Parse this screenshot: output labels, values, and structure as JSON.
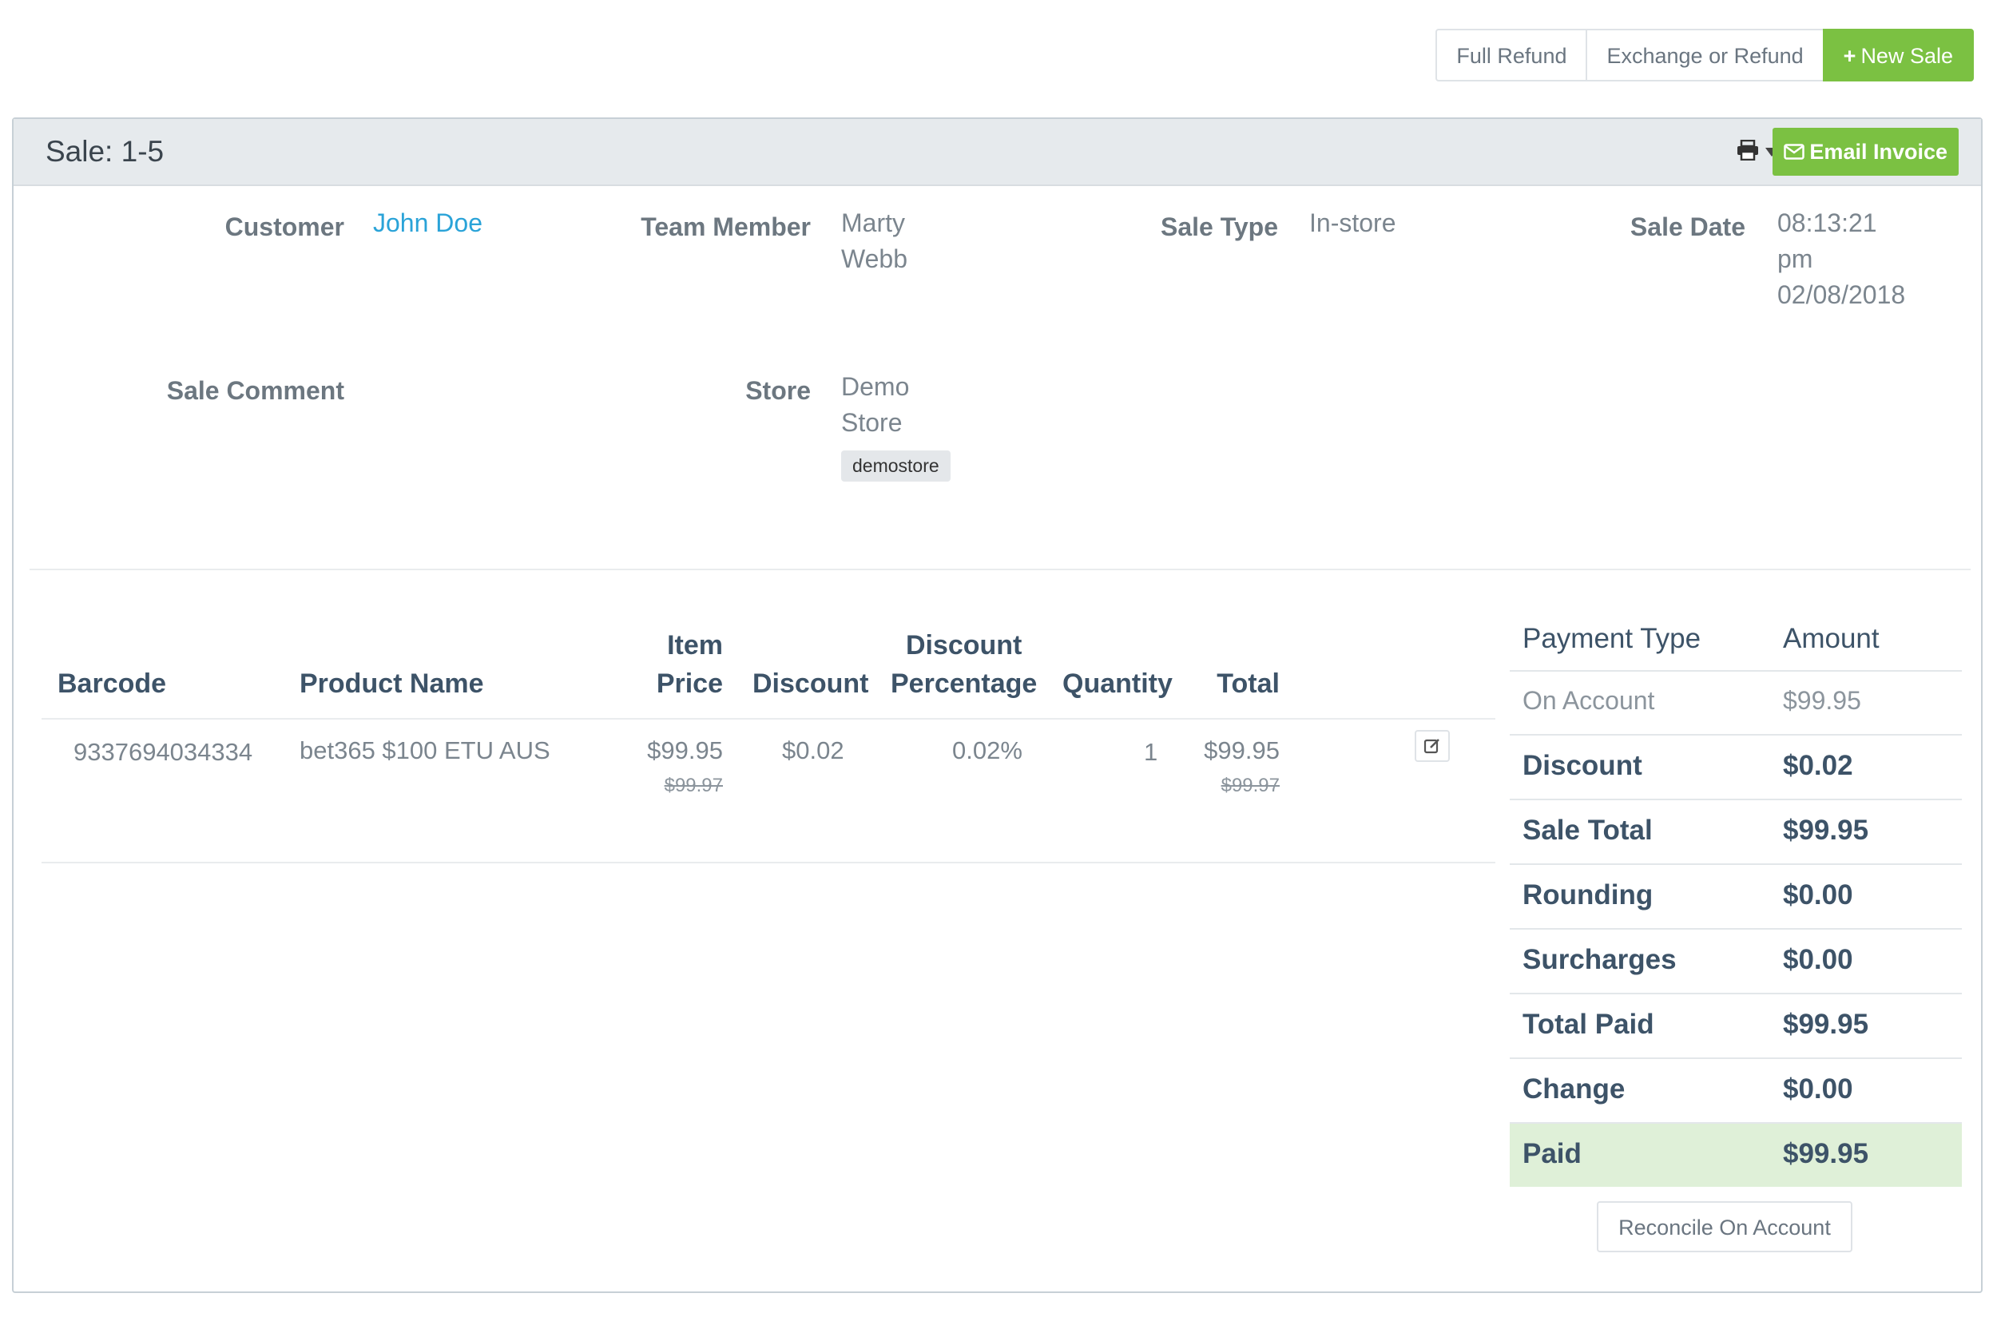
{
  "top_actions": {
    "full_refund": "Full Refund",
    "exchange_or_refund": "Exchange or Refund",
    "new_sale": "New Sale"
  },
  "header": {
    "title": "Sale: 1-5",
    "print_icon": "print-icon",
    "email_invoice": "Email Invoice"
  },
  "info": {
    "customer_label": "Customer",
    "customer_value": "John Doe",
    "team_member_label": "Team Member",
    "team_member_line1": "Marty",
    "team_member_line2": "Webb",
    "sale_type_label": "Sale Type",
    "sale_type_value": "In-store",
    "sale_date_label": "Sale Date",
    "sale_date_line1": "08:13:21",
    "sale_date_line2": "pm",
    "sale_date_line3": "02/08/2018",
    "sale_comment_label": "Sale Comment",
    "store_label": "Store",
    "store_line1": "Demo",
    "store_line2": "Store",
    "store_tag": "demostore"
  },
  "items_table": {
    "headers": {
      "barcode": "Barcode",
      "product_name": "Product Name",
      "item_price_1": "Item",
      "item_price_2": "Price",
      "discount": "Discount",
      "discount_pct_1": "Discount",
      "discount_pct_2": "Percentage",
      "quantity": "Quantity",
      "total": "Total"
    },
    "rows": [
      {
        "barcode": "9337694034334",
        "product_name": "bet365 $100 ETU AUS",
        "item_price": "$99.95",
        "item_price_original": "$99.97",
        "discount": "$0.02",
        "discount_pct": "0.02%",
        "quantity": "1",
        "total": "$99.95",
        "total_original": "$99.97"
      }
    ]
  },
  "payments": {
    "header_type": "Payment Type",
    "header_amount": "Amount",
    "rows": [
      {
        "label": "On Account",
        "value": "$99.95"
      },
      {
        "label": "Discount",
        "value": "$0.02"
      },
      {
        "label": "Sale Total",
        "value": "$99.95"
      },
      {
        "label": "Rounding",
        "value": "$0.00"
      },
      {
        "label": "Surcharges",
        "value": "$0.00"
      },
      {
        "label": "Total Paid",
        "value": "$99.95"
      },
      {
        "label": "Change",
        "value": "$0.00"
      },
      {
        "label": "Paid",
        "value": "$99.95"
      }
    ],
    "reconcile": "Reconcile On Account"
  },
  "colors": {
    "accent_green": "#7bc142",
    "link_blue": "#2aa3d8",
    "paid_row_bg": "#dff0d8"
  }
}
